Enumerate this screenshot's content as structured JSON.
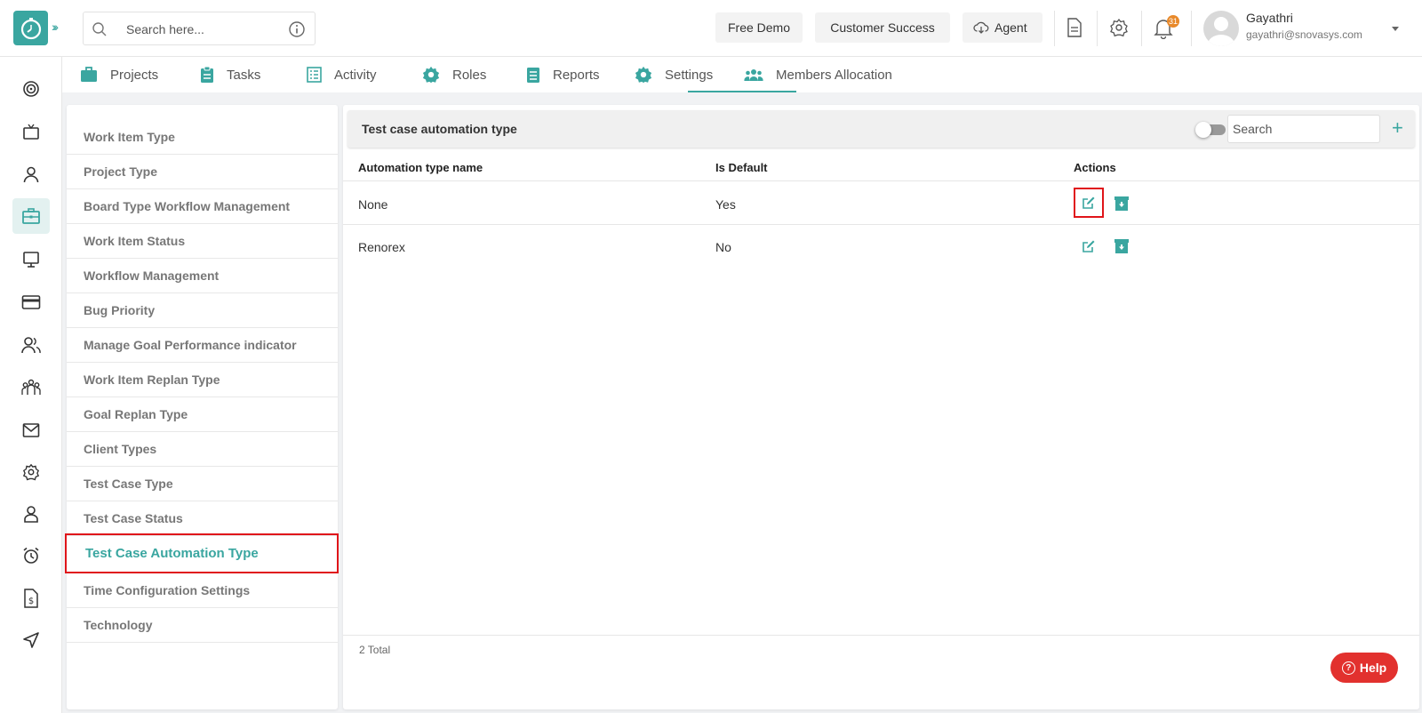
{
  "header": {
    "search_placeholder": "Search here...",
    "buttons": {
      "free_demo": "Free Demo",
      "customer_success": "Customer Success",
      "agent": "Agent"
    },
    "notification_count": "31",
    "user": {
      "name": "Gayathri",
      "email": "gayathri@snovasys.com"
    }
  },
  "nav": {
    "tabs": [
      {
        "label": "Projects",
        "icon": "briefcase-icon"
      },
      {
        "label": "Tasks",
        "icon": "clipboard-icon"
      },
      {
        "label": "Activity",
        "icon": "list-icon"
      },
      {
        "label": "Roles",
        "icon": "gear-icon"
      },
      {
        "label": "Reports",
        "icon": "report-icon"
      },
      {
        "label": "Settings",
        "icon": "gear-icon",
        "active": true
      },
      {
        "label": "Members Allocation",
        "icon": "users-icon"
      }
    ]
  },
  "settings_menu": {
    "items": [
      "Work Item Type",
      "Project Type",
      "Board Type Workflow Management",
      "Work Item Status",
      "Workflow Management",
      "Bug Priority",
      "Manage Goal Performance indicator",
      "Work Item Replan Type",
      "Goal Replan Type",
      "Client Types",
      "Test Case Type",
      "Test Case Status",
      "Test Case Automation Type",
      "Time Configuration Settings",
      "Technology"
    ],
    "active_index": 12
  },
  "panel": {
    "title": "Test case automation type",
    "search_placeholder": "Search",
    "columns": {
      "name": "Automation type name",
      "is_default": "Is Default",
      "actions": "Actions"
    },
    "rows": [
      {
        "name": "None",
        "is_default": "Yes"
      },
      {
        "name": "Renorex",
        "is_default": "No"
      }
    ],
    "total_label": "2 Total"
  },
  "help_label": "Help",
  "colors": {
    "accent": "#3aa6a0",
    "highlight": "#e0151a",
    "help": "#e2312e",
    "badge": "#e8892b"
  }
}
